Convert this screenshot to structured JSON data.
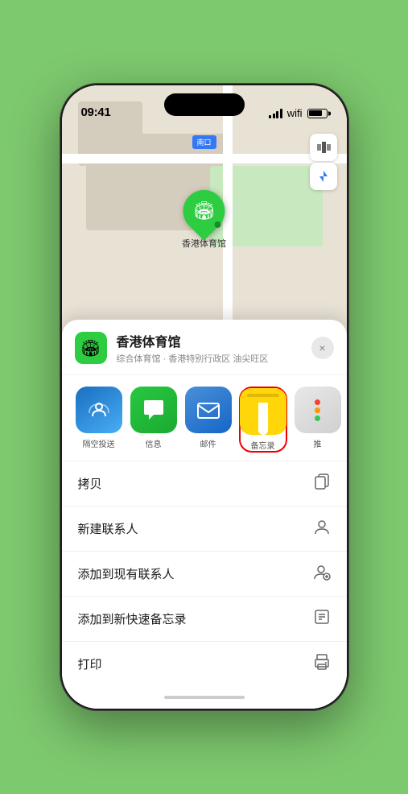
{
  "status": {
    "time": "09:41",
    "location_arrow": "▶"
  },
  "map": {
    "label": "南口",
    "map_icon": "🗺",
    "location_icon": "⊕"
  },
  "location_card": {
    "name": "香港体育馆",
    "description": "综合体育馆 · 香港特别行政区 油尖旺区",
    "close_label": "×",
    "icon": "🏟"
  },
  "share_items": [
    {
      "id": "airdrop",
      "label": "隔空投送",
      "type": "airdrop"
    },
    {
      "id": "messages",
      "label": "信息",
      "type": "messages"
    },
    {
      "id": "mail",
      "label": "邮件",
      "type": "mail"
    },
    {
      "id": "notes",
      "label": "备忘录",
      "type": "notes",
      "selected": true
    },
    {
      "id": "more",
      "label": "推",
      "type": "more"
    }
  ],
  "menu_items": [
    {
      "label": "拷贝",
      "icon": "copy"
    },
    {
      "label": "新建联系人",
      "icon": "person"
    },
    {
      "label": "添加到现有联系人",
      "icon": "person-add"
    },
    {
      "label": "添加到新快速备忘录",
      "icon": "note"
    },
    {
      "label": "打印",
      "icon": "print"
    }
  ]
}
